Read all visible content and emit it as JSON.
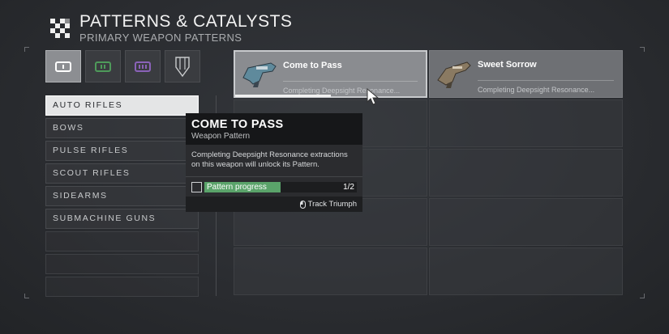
{
  "header": {
    "title": "PATTERNS & CATALYSTS",
    "subtitle": "PRIMARY WEAPON PATTERNS"
  },
  "tabs": [
    {
      "icon": "primary-weapon-icon",
      "active": true
    },
    {
      "icon": "special-weapon-icon",
      "active": false
    },
    {
      "icon": "heavy-weapon-icon",
      "active": false
    },
    {
      "icon": "catalyst-icon",
      "active": false
    }
  ],
  "categories": [
    "AUTO RIFLES",
    "BOWS",
    "PULSE RIFLES",
    "SCOUT RIFLES",
    "SIDEARMS",
    "SUBMACHINE GUNS"
  ],
  "weapons": [
    {
      "name": "Come to Pass",
      "desc": "Completing Deepsight Resonance..."
    },
    {
      "name": "Sweet Sorrow",
      "desc": "Completing Deepsight Resonance..."
    }
  ],
  "tooltip": {
    "title": "COME TO PASS",
    "type": "Weapon Pattern",
    "description": "Completing Deepsight Resonance extractions on this weapon will unlock its Pattern.",
    "objective_label": "Pattern progress",
    "objective_count": "1/2",
    "progress": 0.5,
    "track_label": "Track Triumph"
  },
  "colors": {
    "progress_green": "#5aa36a",
    "selected_card": "#8a8c90",
    "background": "#2a2c30"
  }
}
